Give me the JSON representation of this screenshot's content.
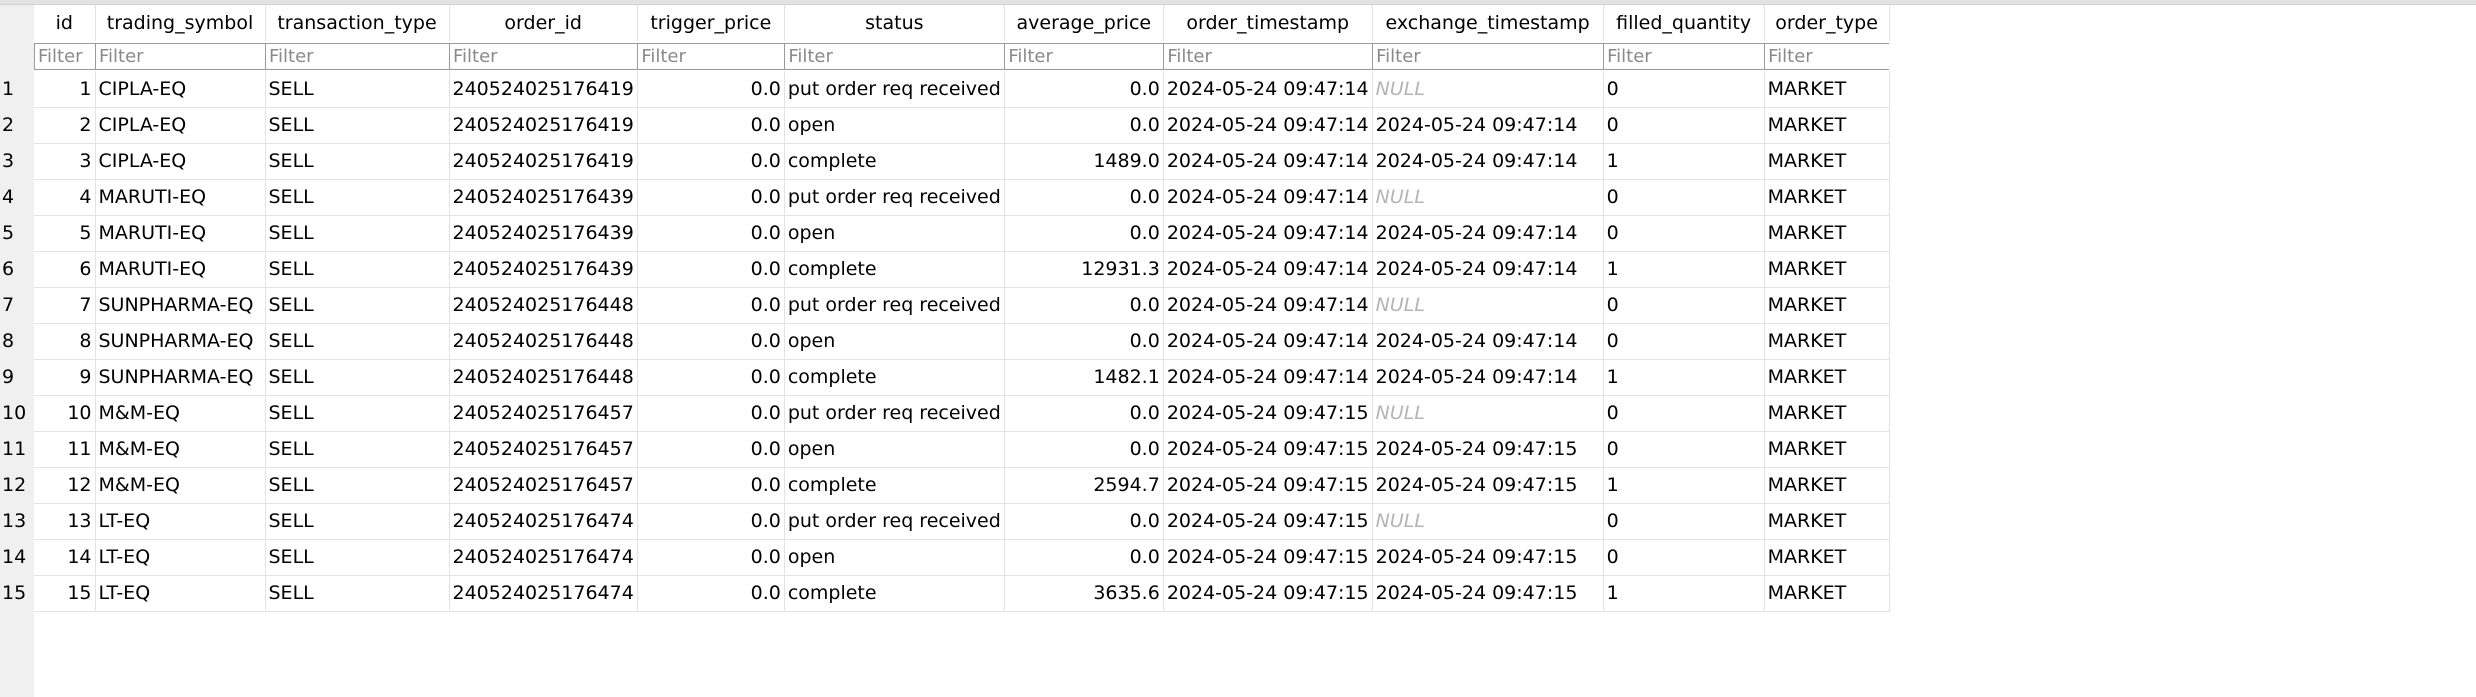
{
  "columns": [
    {
      "key": "id",
      "label": "id"
    },
    {
      "key": "trading_symbol",
      "label": "trading_symbol"
    },
    {
      "key": "transaction_type",
      "label": "transaction_type"
    },
    {
      "key": "order_id",
      "label": "order_id"
    },
    {
      "key": "trigger_price",
      "label": "trigger_price"
    },
    {
      "key": "status",
      "label": "status"
    },
    {
      "key": "average_price",
      "label": "average_price"
    },
    {
      "key": "order_timestamp",
      "label": "order_timestamp"
    },
    {
      "key": "exchange_timestamp",
      "label": "exchange_timestamp"
    },
    {
      "key": "filled_quantity",
      "label": "filled_quantity"
    },
    {
      "key": "order_type",
      "label": "order_type"
    }
  ],
  "filter_placeholder": "Filter",
  "null_text": "NULL",
  "rows": [
    {
      "rownum": "1",
      "id": "1",
      "trading_symbol": "CIPLA-EQ",
      "transaction_type": "SELL",
      "order_id": "240524025176419",
      "trigger_price": "0.0",
      "status": "put order req received",
      "average_price": "0.0",
      "order_timestamp": "2024-05-24 09:47:14",
      "exchange_timestamp": null,
      "filled_quantity": "0",
      "order_type": "MARKET"
    },
    {
      "rownum": "2",
      "id": "2",
      "trading_symbol": "CIPLA-EQ",
      "transaction_type": "SELL",
      "order_id": "240524025176419",
      "trigger_price": "0.0",
      "status": "open",
      "average_price": "0.0",
      "order_timestamp": "2024-05-24 09:47:14",
      "exchange_timestamp": "2024-05-24 09:47:14",
      "filled_quantity": "0",
      "order_type": "MARKET"
    },
    {
      "rownum": "3",
      "id": "3",
      "trading_symbol": "CIPLA-EQ",
      "transaction_type": "SELL",
      "order_id": "240524025176419",
      "trigger_price": "0.0",
      "status": "complete",
      "average_price": "1489.0",
      "order_timestamp": "2024-05-24 09:47:14",
      "exchange_timestamp": "2024-05-24 09:47:14",
      "filled_quantity": "1",
      "order_type": "MARKET"
    },
    {
      "rownum": "4",
      "id": "4",
      "trading_symbol": "MARUTI-EQ",
      "transaction_type": "SELL",
      "order_id": "240524025176439",
      "trigger_price": "0.0",
      "status": "put order req received",
      "average_price": "0.0",
      "order_timestamp": "2024-05-24 09:47:14",
      "exchange_timestamp": null,
      "filled_quantity": "0",
      "order_type": "MARKET"
    },
    {
      "rownum": "5",
      "id": "5",
      "trading_symbol": "MARUTI-EQ",
      "transaction_type": "SELL",
      "order_id": "240524025176439",
      "trigger_price": "0.0",
      "status": "open",
      "average_price": "0.0",
      "order_timestamp": "2024-05-24 09:47:14",
      "exchange_timestamp": "2024-05-24 09:47:14",
      "filled_quantity": "0",
      "order_type": "MARKET"
    },
    {
      "rownum": "6",
      "id": "6",
      "trading_symbol": "MARUTI-EQ",
      "transaction_type": "SELL",
      "order_id": "240524025176439",
      "trigger_price": "0.0",
      "status": "complete",
      "average_price": "12931.3",
      "order_timestamp": "2024-05-24 09:47:14",
      "exchange_timestamp": "2024-05-24 09:47:14",
      "filled_quantity": "1",
      "order_type": "MARKET"
    },
    {
      "rownum": "7",
      "id": "7",
      "trading_symbol": "SUNPHARMA-EQ",
      "transaction_type": "SELL",
      "order_id": "240524025176448",
      "trigger_price": "0.0",
      "status": "put order req received",
      "average_price": "0.0",
      "order_timestamp": "2024-05-24 09:47:14",
      "exchange_timestamp": null,
      "filled_quantity": "0",
      "order_type": "MARKET"
    },
    {
      "rownum": "8",
      "id": "8",
      "trading_symbol": "SUNPHARMA-EQ",
      "transaction_type": "SELL",
      "order_id": "240524025176448",
      "trigger_price": "0.0",
      "status": "open",
      "average_price": "0.0",
      "order_timestamp": "2024-05-24 09:47:14",
      "exchange_timestamp": "2024-05-24 09:47:14",
      "filled_quantity": "0",
      "order_type": "MARKET"
    },
    {
      "rownum": "9",
      "id": "9",
      "trading_symbol": "SUNPHARMA-EQ",
      "transaction_type": "SELL",
      "order_id": "240524025176448",
      "trigger_price": "0.0",
      "status": "complete",
      "average_price": "1482.1",
      "order_timestamp": "2024-05-24 09:47:14",
      "exchange_timestamp": "2024-05-24 09:47:14",
      "filled_quantity": "1",
      "order_type": "MARKET"
    },
    {
      "rownum": "10",
      "id": "10",
      "trading_symbol": "M&M-EQ",
      "transaction_type": "SELL",
      "order_id": "240524025176457",
      "trigger_price": "0.0",
      "status": "put order req received",
      "average_price": "0.0",
      "order_timestamp": "2024-05-24 09:47:15",
      "exchange_timestamp": null,
      "filled_quantity": "0",
      "order_type": "MARKET"
    },
    {
      "rownum": "11",
      "id": "11",
      "trading_symbol": "M&M-EQ",
      "transaction_type": "SELL",
      "order_id": "240524025176457",
      "trigger_price": "0.0",
      "status": "open",
      "average_price": "0.0",
      "order_timestamp": "2024-05-24 09:47:15",
      "exchange_timestamp": "2024-05-24 09:47:15",
      "filled_quantity": "0",
      "order_type": "MARKET"
    },
    {
      "rownum": "12",
      "id": "12",
      "trading_symbol": "M&M-EQ",
      "transaction_type": "SELL",
      "order_id": "240524025176457",
      "trigger_price": "0.0",
      "status": "complete",
      "average_price": "2594.7",
      "order_timestamp": "2024-05-24 09:47:15",
      "exchange_timestamp": "2024-05-24 09:47:15",
      "filled_quantity": "1",
      "order_type": "MARKET"
    },
    {
      "rownum": "13",
      "id": "13",
      "trading_symbol": "LT-EQ",
      "transaction_type": "SELL",
      "order_id": "240524025176474",
      "trigger_price": "0.0",
      "status": "put order req received",
      "average_price": "0.0",
      "order_timestamp": "2024-05-24 09:47:15",
      "exchange_timestamp": null,
      "filled_quantity": "0",
      "order_type": "MARKET"
    },
    {
      "rownum": "14",
      "id": "14",
      "trading_symbol": "LT-EQ",
      "transaction_type": "SELL",
      "order_id": "240524025176474",
      "trigger_price": "0.0",
      "status": "open",
      "average_price": "0.0",
      "order_timestamp": "2024-05-24 09:47:15",
      "exchange_timestamp": "2024-05-24 09:47:15",
      "filled_quantity": "0",
      "order_type": "MARKET"
    },
    {
      "rownum": "15",
      "id": "15",
      "trading_symbol": "LT-EQ",
      "transaction_type": "SELL",
      "order_id": "240524025176474",
      "trigger_price": "0.0",
      "status": "complete",
      "average_price": "3635.6",
      "order_timestamp": "2024-05-24 09:47:15",
      "exchange_timestamp": "2024-05-24 09:47:15",
      "filled_quantity": "1",
      "order_type": "MARKET"
    }
  ]
}
